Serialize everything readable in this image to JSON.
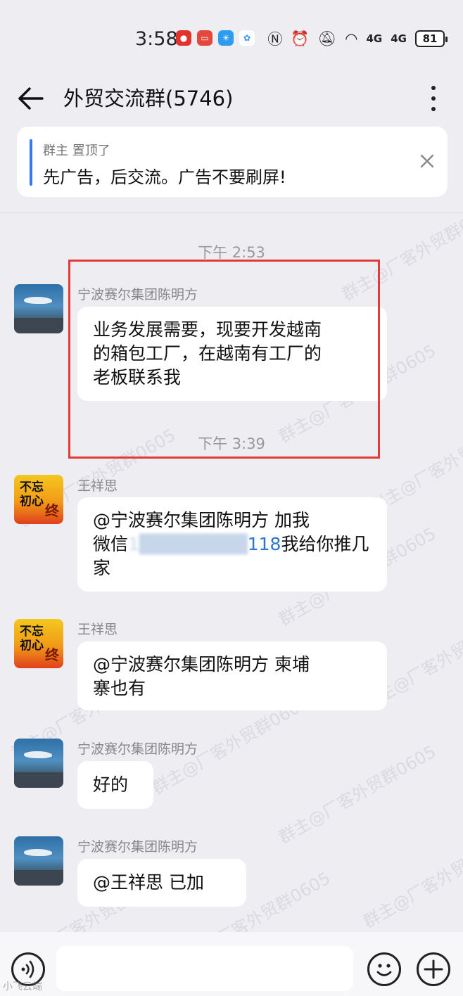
{
  "status_bar": {
    "time": "3:58",
    "network": "4G",
    "battery": "81"
  },
  "header": {
    "title": "外贸交流群(5746)"
  },
  "pinned": {
    "meta": "群主 置顶了",
    "text": "先广告，后交流。广告不要刷屏!"
  },
  "messages": [
    {
      "time": "下午 2:53"
    },
    {
      "sender": "宁波赛尔集团陈明方",
      "lines": [
        "业务发展需要，现要开发越南",
        "的箱包工厂，在越南有工厂的",
        "老板联系我"
      ]
    },
    {
      "time": "下午 3:39"
    },
    {
      "sender": "王祥思",
      "lines": [
        "@宁波赛尔集团陈明方  加我",
        "微信",
        "118",
        "我给你推几",
        "家"
      ],
      "blurred": "1████████"
    },
    {
      "sender": "王祥思",
      "lines": [
        "@宁波赛尔集团陈明方  柬埔",
        "寨也有"
      ]
    },
    {
      "sender": "宁波赛尔集团陈明方",
      "lines": [
        "好的"
      ]
    },
    {
      "sender": "宁波赛尔集团陈明方",
      "lines": [
        "@王祥思  已加"
      ]
    }
  ],
  "avatars": {
    "calligraphy_text_1": "不忘",
    "calligraphy_text_2": "初心",
    "calligraphy_text_3": "终"
  },
  "watermark": "群主@厂客外贸群0605",
  "corner_watermark": "小飞云端",
  "colors": {
    "accent": "#3478f6",
    "highlight": "#e23b3b",
    "background": "#ededf2"
  },
  "icons": {
    "back": "arrow-left-icon",
    "more": "more-vertical-icon",
    "close": "close-icon",
    "voice": "voice-icon",
    "emoji": "emoji-icon",
    "plus": "plus-icon"
  }
}
